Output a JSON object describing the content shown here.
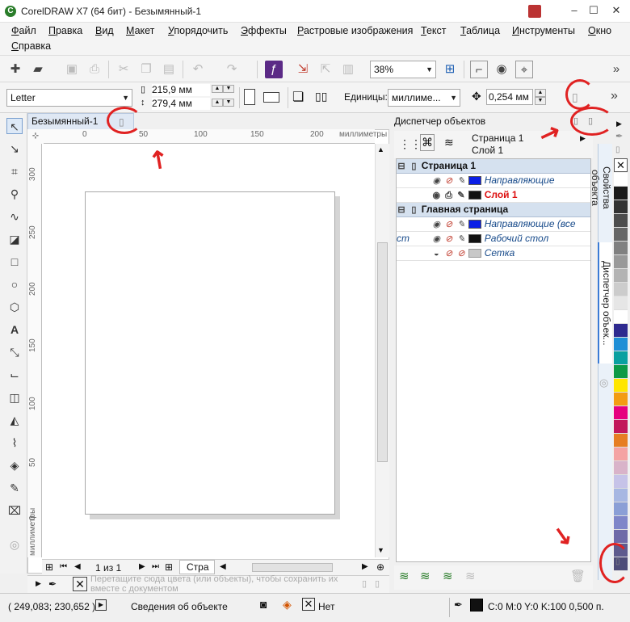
{
  "app": {
    "title": "CorelDRAW X7 (64 бит) - Безымянный-1",
    "icon_letter": "C"
  },
  "window_controls": [
    "–",
    "☐",
    "✕"
  ],
  "menu": [
    "Файл",
    "Правка",
    "Вид",
    "Макет",
    "Упорядочить",
    "Эффекты",
    "Растровые изображения",
    "Текст",
    "Таблица",
    "Инструменты",
    "Окно",
    "Справка"
  ],
  "toolbar": {
    "zoom": "38%"
  },
  "propbar": {
    "paper": "Letter",
    "width": "215,9 мм",
    "height": "279,4 мм",
    "units_label": "Единицы:",
    "units_value": "миллиме...",
    "nudge": "0,254 мм"
  },
  "document": {
    "tab": "Безымянный-1",
    "ruler_unit": "миллиметры",
    "h_ticks": [
      "0",
      "50",
      "100",
      "150",
      "200"
    ],
    "v_ticks": [
      "300",
      "250",
      "200",
      "150",
      "100",
      "50",
      "0"
    ],
    "page_nav": "1 из 1",
    "page_tab": "Стра",
    "colorbar_hint": "Перетащите сюда цвета (или объекты), чтобы сохранить их вместе с документом"
  },
  "object_manager": {
    "title": "Диспетчер объектов",
    "current_page": "Страница 1",
    "current_layer": "Слой 1",
    "tree": [
      {
        "kind": "page",
        "label": "Страница 1"
      },
      {
        "kind": "layer",
        "label": "Направляющие",
        "color": "#0a1ee6"
      },
      {
        "kind": "layer-active",
        "label": "Слой 1",
        "color": "#111111"
      },
      {
        "kind": "page",
        "label": "Главная страница"
      },
      {
        "kind": "layer",
        "label": "Направляющие (все ст",
        "color": "#0a1ee6"
      },
      {
        "kind": "layer",
        "label": "Рабочий стол",
        "color": "#111111"
      },
      {
        "kind": "layer",
        "label": "Сетка",
        "color": "#c8c8c8"
      }
    ]
  },
  "docker_tabs": [
    "Свойства объекта",
    "Диспетчер объек..."
  ],
  "palette_colors": [
    "#ffffff",
    "#1a1a1a",
    "#333333",
    "#4d4d4d",
    "#666666",
    "#808080",
    "#999999",
    "#b3b3b3",
    "#cccccc",
    "#e6e6e6",
    "#ffffff",
    "#2e2a8f",
    "#1f8fd6",
    "#0aa0a0",
    "#0d9a46",
    "#ffe600",
    "#f39c12",
    "#e6007e",
    "#c2185b",
    "#e67e22",
    "#f4a3a3",
    "#d9b3c9",
    "#c6c3e8",
    "#a7b7e2",
    "#8b9fd6",
    "#7f86c9",
    "#6f6aa8",
    "#5e5b8e",
    "#4e4d79"
  ],
  "status": {
    "coords": "( 249,083; 230,652 )",
    "info": "Сведения об объекте",
    "fill_none": "Нет",
    "outline": "C:0 M:0 Y:0 K:100  0,500 п."
  }
}
